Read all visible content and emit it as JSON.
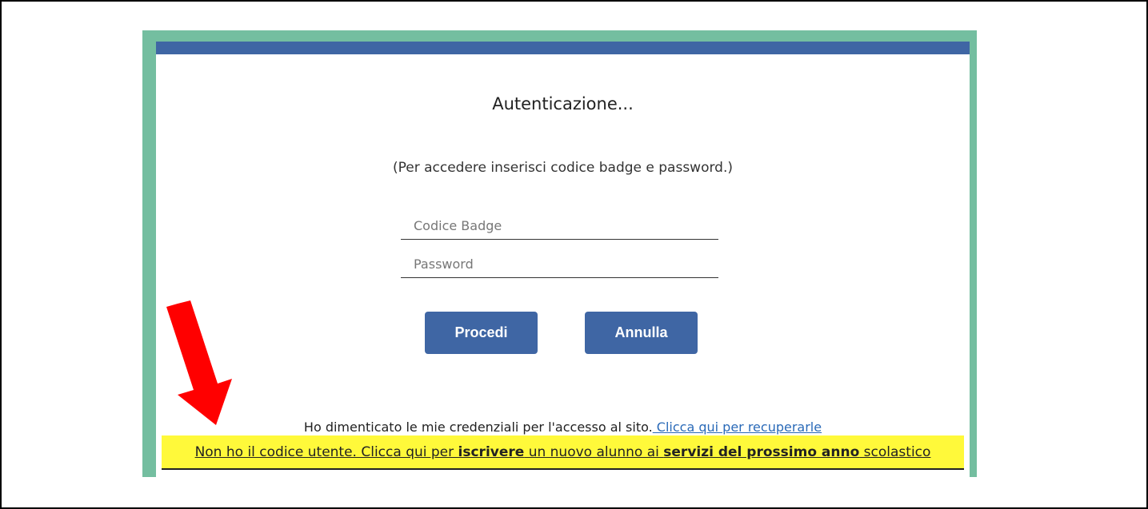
{
  "login": {
    "title": "Autenticazione...",
    "subtitle": "(Per accedere inserisci codice badge e password.)",
    "badge_placeholder": "Codice Badge",
    "password_placeholder": "Password",
    "proceed_label": "Procedi",
    "cancel_label": "Annulla"
  },
  "help": {
    "forgot_text": "Ho dimenticato le mie credenziali per l'accesso al sito.",
    "forgot_link": " Clicca qui per recuperarle",
    "enroll_part1": "Non ho il codice utente. Clicca qui per ",
    "enroll_bold1": "iscrivere",
    "enroll_part2": " un nuovo alunno ai ",
    "enroll_bold2": "servizi del prossimo anno",
    "enroll_part3": " scolastico"
  },
  "colors": {
    "accent_bar": "#3f66a4",
    "panel_border": "#74bea0",
    "highlight": "#fff93a",
    "arrow": "#ff0000"
  }
}
